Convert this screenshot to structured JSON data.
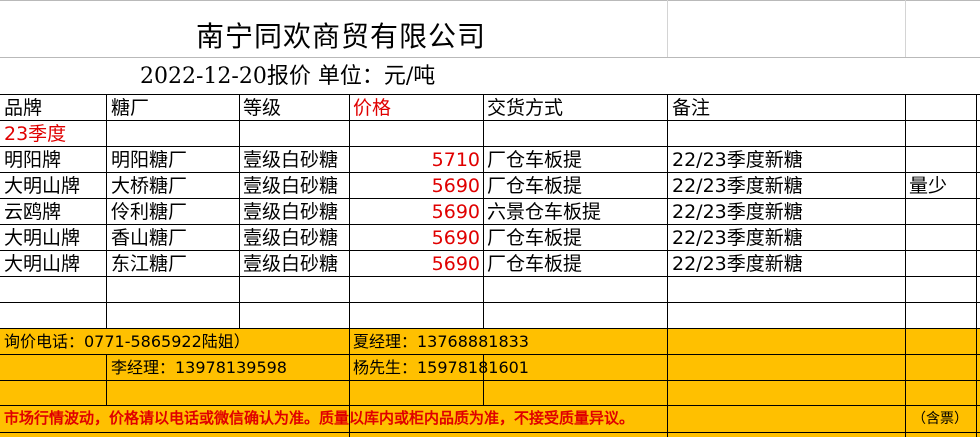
{
  "title": "南宁同欢商贸有限公司",
  "subtitle": "2022-12-20报价   单位：元/吨",
  "headers": {
    "brand": "品牌",
    "mill": "糖厂",
    "grade": "等级",
    "price": "价格",
    "delivery": "交货方式",
    "remark": "备注"
  },
  "section_label": "23季度",
  "rows": [
    {
      "brand": "明阳牌",
      "mill": "明阳糖厂",
      "grade": "壹级白砂糖",
      "price": "5710",
      "delivery": "厂仓车板提",
      "remark": "22/23季度新糖",
      "extra": ""
    },
    {
      "brand": "大明山牌",
      "mill": "大桥糖厂",
      "grade": "壹级白砂糖",
      "price": "5690",
      "delivery": "厂仓车板提",
      "remark": "22/23季度新糖",
      "extra": "量少"
    },
    {
      "brand": "云鸥牌",
      "mill": "伶利糖厂",
      "grade": "壹级白砂糖",
      "price": "5690",
      "delivery": "六景仓车板提",
      "remark": "22/23季度新糖",
      "extra": ""
    },
    {
      "brand": "大明山牌",
      "mill": "香山糖厂",
      "grade": "壹级白砂糖",
      "price": "5690",
      "delivery": "厂仓车板提",
      "remark": "22/23季度新糖",
      "extra": ""
    },
    {
      "brand": "大明山牌",
      "mill": "东江糖厂",
      "grade": "壹级白砂糖",
      "price": "5690",
      "delivery": "厂仓车板提",
      "remark": "22/23季度新糖",
      "extra": ""
    }
  ],
  "contacts": {
    "inquiry": "询价电话：0771-5865922陆姐）",
    "xia": "夏经理：13768881833",
    "li": "李经理：13978139598",
    "yang": "杨先生：15978181601"
  },
  "notice": "市场行情波动，价格请以电话或微信确认为准。质量以库内或柜内品质为准，不接受质量异议。",
  "tax_note": "（含票）",
  "colors": {
    "price_red": "#e00000",
    "band_yellow": "#ffc000"
  }
}
